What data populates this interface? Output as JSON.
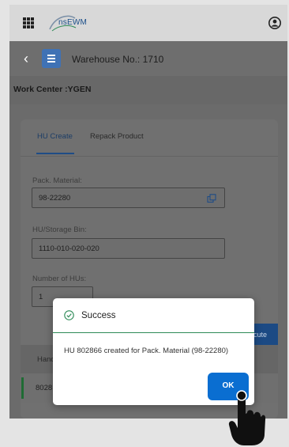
{
  "app": {
    "logo_text": "nsEWM"
  },
  "header": {
    "title": "Warehouse No.: 1710"
  },
  "work_center": {
    "label": "Work Center :YGEN"
  },
  "tabs": [
    {
      "label": "HU Create",
      "active": true
    },
    {
      "label": "Repack Product",
      "active": false
    }
  ],
  "form": {
    "pack_material": {
      "label": "Pack. Material:",
      "value": "98-22280"
    },
    "storage_bin": {
      "label": "HU/Storage Bin:",
      "value": "1110-010-020-020"
    },
    "num_hus": {
      "label": "Number of HUs:",
      "value": "1"
    }
  },
  "execute_button": {
    "label": "ecute"
  },
  "table": {
    "header": "Hand",
    "rows": [
      {
        "value": "8028"
      }
    ]
  },
  "dialog": {
    "title": "Success",
    "message": "HU 802866 created for Pack. Material (98-22280)",
    "ok_label": "OK"
  },
  "colors": {
    "accent": "#0a6ed1",
    "success": "#2e8b57",
    "brand": "#1b4f8a"
  }
}
